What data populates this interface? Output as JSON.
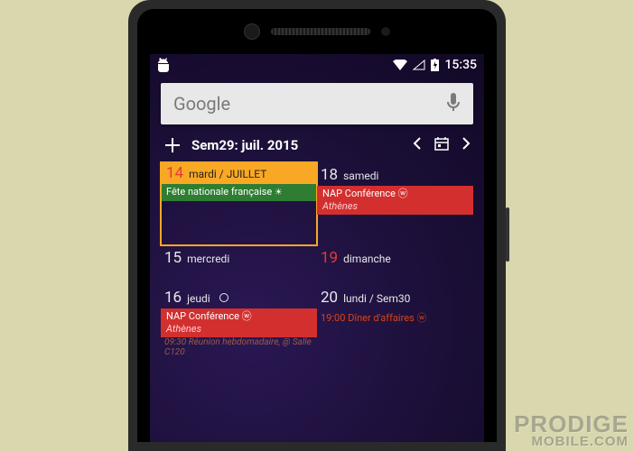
{
  "status": {
    "time": "15:35"
  },
  "search": {
    "placeholder": "Google"
  },
  "widget": {
    "title": "Sem29: juil. 2015"
  },
  "days": [
    {
      "num": "14",
      "name": "mardi / JUILLET",
      "highlight": true,
      "num_red": true,
      "events": [
        {
          "kind": "green",
          "title": "Fête nationale française",
          "sun": true
        }
      ]
    },
    {
      "num": "18",
      "name": "samedi",
      "events": [
        {
          "kind": "red",
          "title": "NAP Conférence ⓦ",
          "loc": "Athènes"
        }
      ]
    },
    {
      "num": "15",
      "name": "mercredi",
      "events": []
    },
    {
      "num": "19",
      "name": "dimanche",
      "num_red": true,
      "events": []
    },
    {
      "num": "16",
      "name": "jeudi",
      "circle": true,
      "events": [
        {
          "kind": "red",
          "title": "NAP Conférence ⓦ",
          "loc": "Athènes"
        },
        {
          "kind": "plain",
          "text": "09:30 Réunion hebdomadaire, @ Salle C120"
        }
      ]
    },
    {
      "num": "20",
      "name": "lundi / Sem30",
      "events": [
        {
          "kind": "orange",
          "text": "19:00 Dîner d'affaires ⓦ"
        }
      ]
    }
  ],
  "watermark": {
    "line1": "PRODIGE",
    "line2": "MOBILE.COM"
  }
}
